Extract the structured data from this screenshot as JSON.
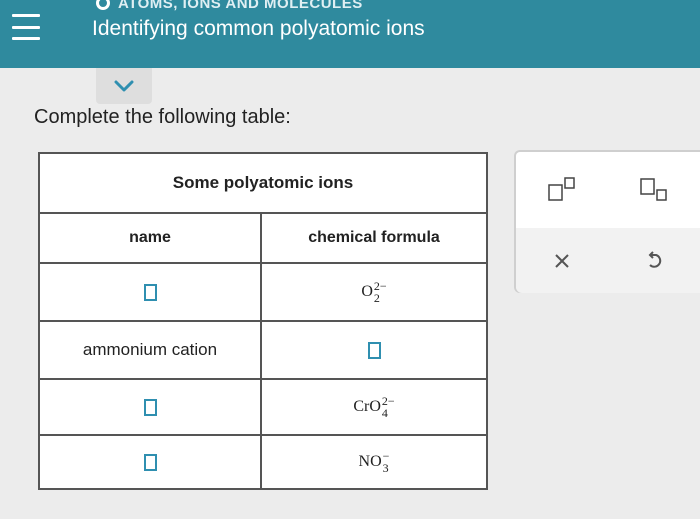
{
  "header": {
    "breadcrumb": "ATOMS, IONS AND MOLECULES",
    "title": "Identifying common polyatomic ions"
  },
  "instruction": "Complete the following table:",
  "table": {
    "caption": "Some polyatomic ions",
    "columns": {
      "name": "name",
      "formula": "chemical formula"
    },
    "rows": [
      {
        "name": "",
        "name_input": true,
        "formula_base": "O",
        "formula_sub": "2",
        "formula_sup": "2−",
        "formula_input": false
      },
      {
        "name": "ammonium cation",
        "name_input": false,
        "formula_base": "",
        "formula_sub": "",
        "formula_sup": "",
        "formula_input": true
      },
      {
        "name": "",
        "name_input": true,
        "formula_base": "CrO",
        "formula_sub": "4",
        "formula_sup": "2−",
        "formula_input": false
      },
      {
        "name": "",
        "name_input": true,
        "formula_base": "NO",
        "formula_sub": "3",
        "formula_sup": "−",
        "formula_input": false
      }
    ]
  },
  "palette": {
    "tools": [
      "superscript-icon",
      "subscript-icon",
      "close-icon",
      "undo-icon"
    ]
  },
  "colors": {
    "header": "#2f8a9e",
    "input_border": "#2f8fb0",
    "table_border": "#555555"
  }
}
